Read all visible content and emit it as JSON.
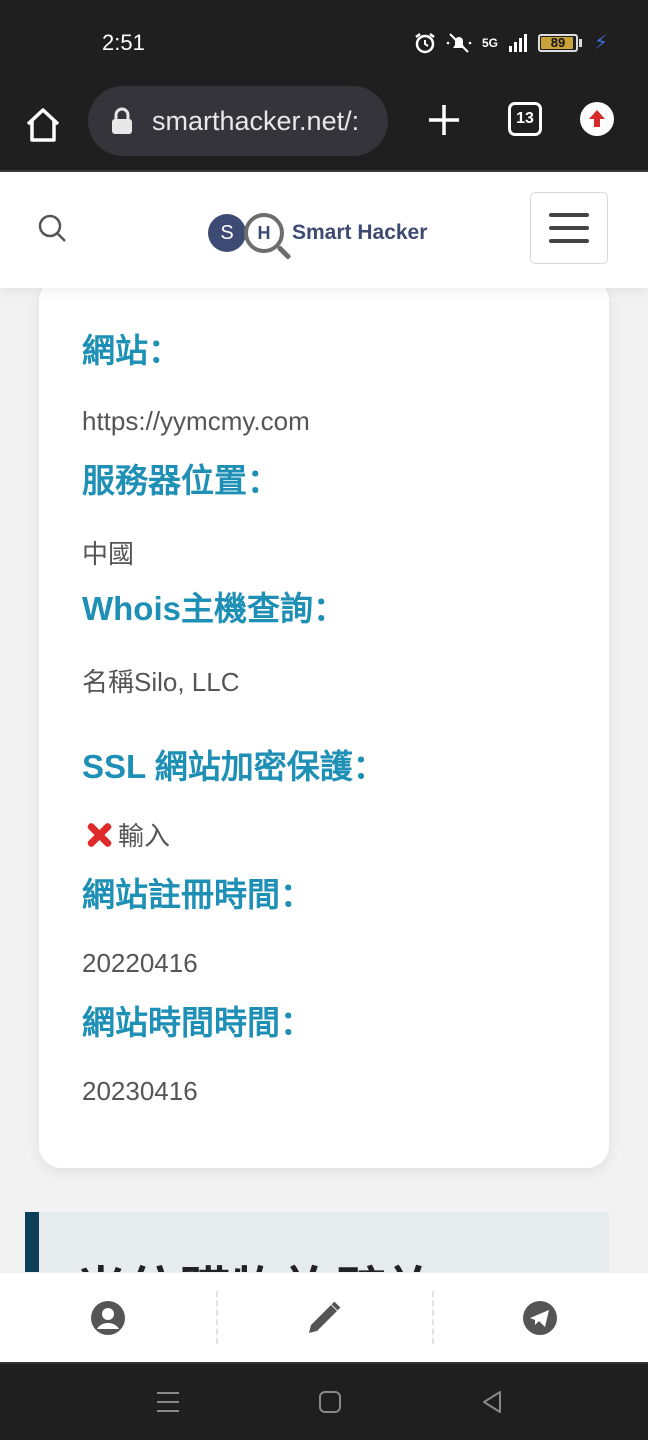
{
  "status_bar": {
    "time": "2:51",
    "network": "5G",
    "battery": "89",
    "battery_level": 0.89,
    "icons": [
      "alarm-icon",
      "mute-icon",
      "signal-icon",
      "battery-icon",
      "charging-icon"
    ]
  },
  "browser": {
    "url": "smarthacker.net/:",
    "tab_count": "13"
  },
  "site": {
    "logo_s": "S",
    "logo_h": "H",
    "logo_text": "Smart Hacker"
  },
  "info": {
    "website_label": "網站：",
    "website_value": "https://yymcmy.com",
    "server_label": "服務器位置：",
    "server_value": "中國",
    "whois_label": "Whois主機查詢：",
    "whois_value": "名稱Silo, LLC",
    "ssl_label": "SSL 網站加密保護：",
    "ssl_value": "輸入",
    "registered_label": "網站註冊時間：",
    "registered_value": "20220416",
    "expiry_label": "網站時間時間：",
    "expiry_value": "20230416"
  },
  "next_section": {
    "title": "光仿購物詐騙詐"
  },
  "colors": {
    "accent": "#1e8fb5",
    "brand": "#3d4a73",
    "error": "#e02a2a"
  }
}
